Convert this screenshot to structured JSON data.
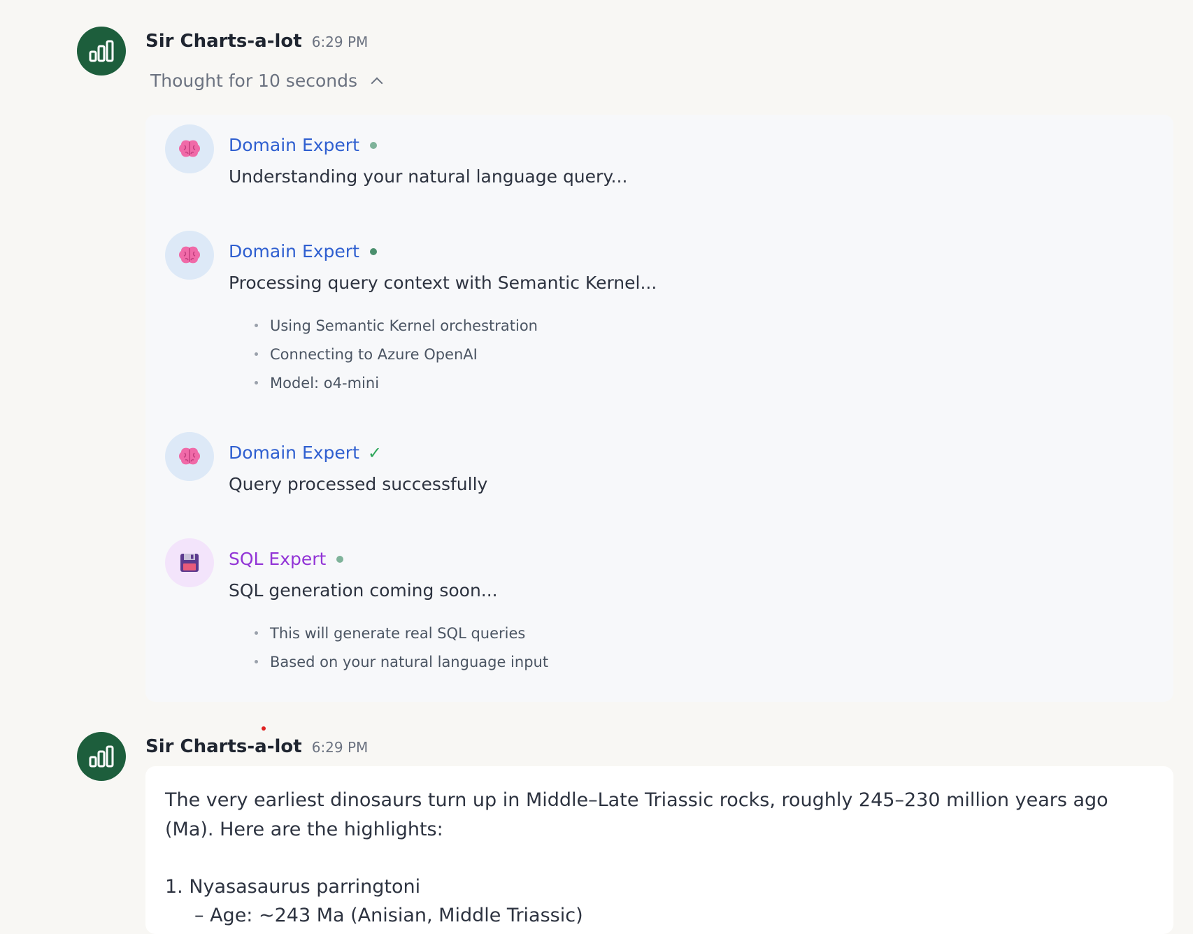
{
  "messages": [
    {
      "sender": "Sir Charts-a-lot",
      "time": "6:29 PM",
      "thought_toggle": "Thought for 10 seconds",
      "steps": [
        {
          "agent": "Domain Expert",
          "icon": "brain-icon",
          "status": "in-progress",
          "text": "Understanding your natural language query...",
          "details": []
        },
        {
          "agent": "Domain Expert",
          "icon": "brain-icon",
          "status": "in-progress",
          "text": "Processing query context with Semantic Kernel...",
          "details": [
            "Using Semantic Kernel orchestration",
            "Connecting to Azure OpenAI",
            "Model: o4-mini"
          ]
        },
        {
          "agent": "Domain Expert",
          "icon": "brain-icon",
          "status": "complete",
          "status_symbol": "✓",
          "text": "Query processed successfully",
          "details": []
        },
        {
          "agent": "SQL Expert",
          "icon": "floppy-disk-icon",
          "status": "in-progress",
          "text": "SQL generation coming soon...",
          "details": [
            "This will generate real SQL queries",
            "Based on your natural language input"
          ]
        }
      ]
    },
    {
      "sender": "Sir Charts-a-lot",
      "time": "6:29 PM",
      "answer": {
        "paragraph": "The very earliest dinosaurs turn up in Middle–Late Triassic rocks, roughly 245–230 million years ago (Ma).  Here are the highlights:",
        "list_item_1": "1. Nyasasaurus parringtoni",
        "list_item_1_sub": "– Age: ~243 Ma (Anisian, Middle Triassic)"
      }
    }
  ],
  "colors": {
    "page_background": "#f8f7f4",
    "avatar_green": "#1d5e3c",
    "domain_expert_blue": "#2f5fd0",
    "sql_expert_purple": "#9234d6",
    "status_green": "#4a8f6d",
    "check_green": "#2ea65a"
  }
}
